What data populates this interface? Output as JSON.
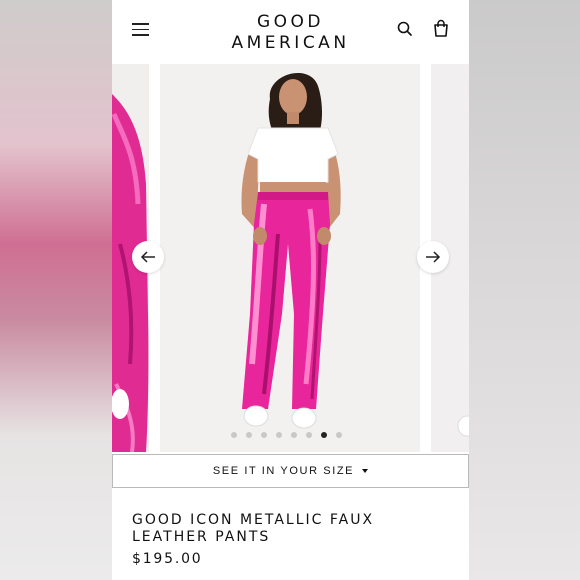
{
  "brand": {
    "line1": "GOOD",
    "line2": "AMERICAN"
  },
  "header": {
    "menu_icon": "hamburger-menu-icon",
    "search_icon": "search-icon",
    "bag_icon": "shopping-bag-icon"
  },
  "carousel": {
    "total_dots": 8,
    "active_dot": 7,
    "prev_icon": "arrow-left-icon",
    "next_icon": "arrow-right-icon",
    "pants_color": "#e8259a",
    "shirt_color": "#ffffff"
  },
  "size_button": {
    "label": "SEE IT IN YOUR SIZE"
  },
  "product": {
    "title": "GOOD ICON METALLIC FAUX LEATHER PANTS",
    "price": "$195.00"
  }
}
